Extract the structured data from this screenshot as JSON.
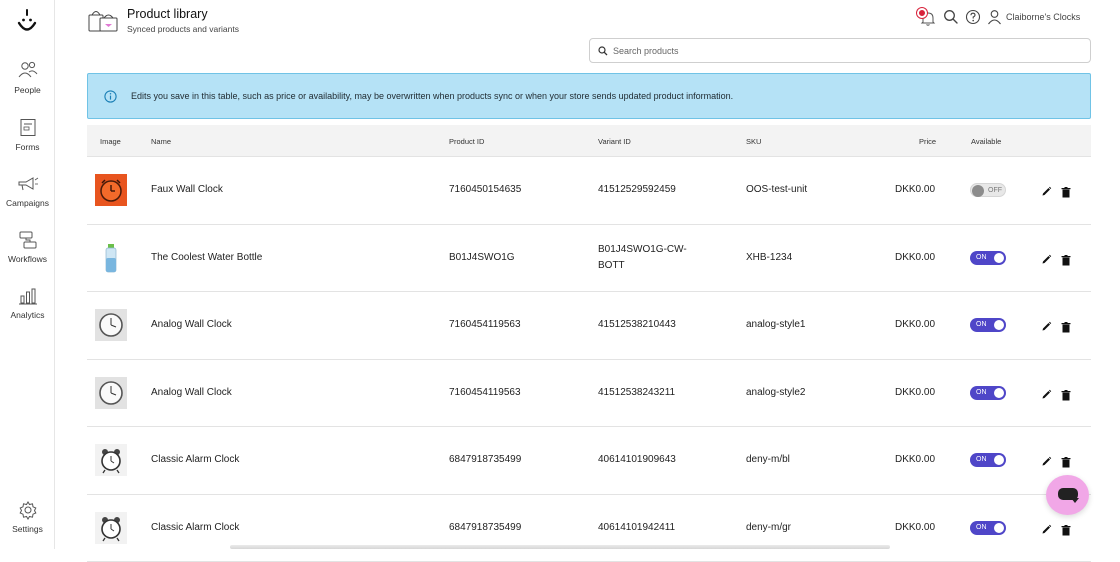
{
  "app": {
    "title": "Product library",
    "subtitle": "Synced products and variants",
    "account_name": "Claiborne's Clocks"
  },
  "sidebar": {
    "items": [
      {
        "label": "People",
        "icon": "people-icon"
      },
      {
        "label": "Forms",
        "icon": "forms-icon"
      },
      {
        "label": "Campaigns",
        "icon": "megaphone-icon"
      },
      {
        "label": "Workflows",
        "icon": "workflows-icon"
      },
      {
        "label": "Analytics",
        "icon": "analytics-icon"
      },
      {
        "label": "Settings",
        "icon": "gear-icon"
      }
    ]
  },
  "search": {
    "placeholder": "Search products",
    "value": ""
  },
  "banner": {
    "text": "Edits you save in this table, such as price or availability, may be overwritten when products sync or when your store sends updated product information."
  },
  "table": {
    "headers": {
      "image": "Image",
      "name": "Name",
      "product_id": "Product ID",
      "variant_id": "Variant ID",
      "sku": "SKU",
      "price": "Price",
      "available": "Available"
    },
    "rows": [
      {
        "image": "orange-clock-thumbnail",
        "name": "Faux Wall Clock",
        "product_id": "7160450154635",
        "variant_id": "41512529592459",
        "variant_id_line2": "",
        "sku": "OOS-test-unit",
        "price": "DKK0.00",
        "available": false,
        "toggle_label": "OFF"
      },
      {
        "image": "water-bottle-thumbnail",
        "name": "The Coolest Water Bottle",
        "product_id": "B01J4SWO1G",
        "variant_id": "B01J4SWO1G-CW-",
        "variant_id_line2": "BOTT",
        "sku": "XHB-1234",
        "price": "DKK0.00",
        "available": true,
        "toggle_label": "ON"
      },
      {
        "image": "analog-clock-thumbnail",
        "name": "Analog Wall Clock",
        "product_id": "7160454119563",
        "variant_id": "41512538210443",
        "variant_id_line2": "",
        "sku": "analog-style1",
        "price": "DKK0.00",
        "available": true,
        "toggle_label": "ON"
      },
      {
        "image": "analog-clock-thumbnail",
        "name": "Analog Wall Clock",
        "product_id": "7160454119563",
        "variant_id": "41512538243211",
        "variant_id_line2": "",
        "sku": "analog-style2",
        "price": "DKK0.00",
        "available": true,
        "toggle_label": "ON"
      },
      {
        "image": "alarm-clock-thumbnail",
        "name": "Classic Alarm Clock",
        "product_id": "6847918735499",
        "variant_id": "40614101909643",
        "variant_id_line2": "",
        "sku": "deny-m/bl",
        "price": "DKK0.00",
        "available": true,
        "toggle_label": "ON"
      },
      {
        "image": "alarm-clock-thumbnail",
        "name": "Classic Alarm Clock",
        "product_id": "6847918735499",
        "variant_id": "40614101942411",
        "variant_id_line2": "",
        "sku": "deny-m/gr",
        "price": "DKK0.00",
        "available": true,
        "toggle_label": "ON"
      }
    ]
  },
  "colors": {
    "accent": "#4f46c8",
    "banner_bg": "#b5e2f6",
    "notification": "#d8223b",
    "chat_button": "#f1a7e7"
  }
}
